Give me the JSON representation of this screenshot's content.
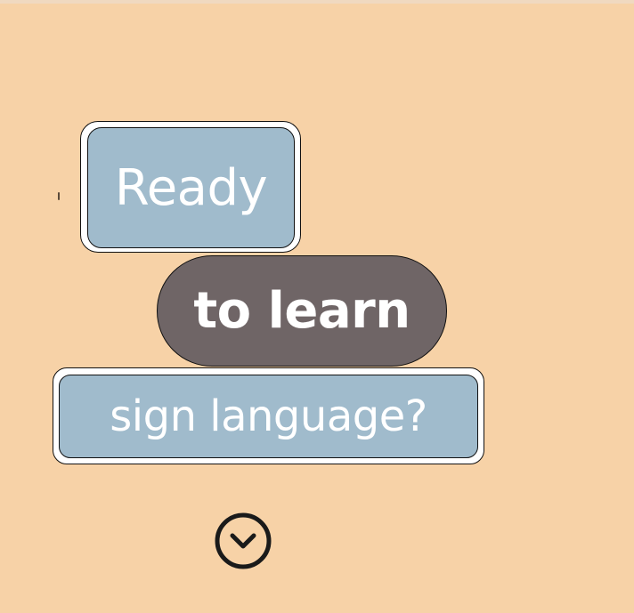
{
  "hero": {
    "line1": "Ready",
    "line2": "to learn",
    "line3": "sign language?"
  },
  "icons": {
    "scroll_down": "chevron-down-circle-icon"
  },
  "colors": {
    "background": "#f7d2a7",
    "chip_blue": "#a0bbcc",
    "pill_gray": "#6f6566",
    "text": "#ffffff",
    "icon": "#1a1a1a"
  }
}
